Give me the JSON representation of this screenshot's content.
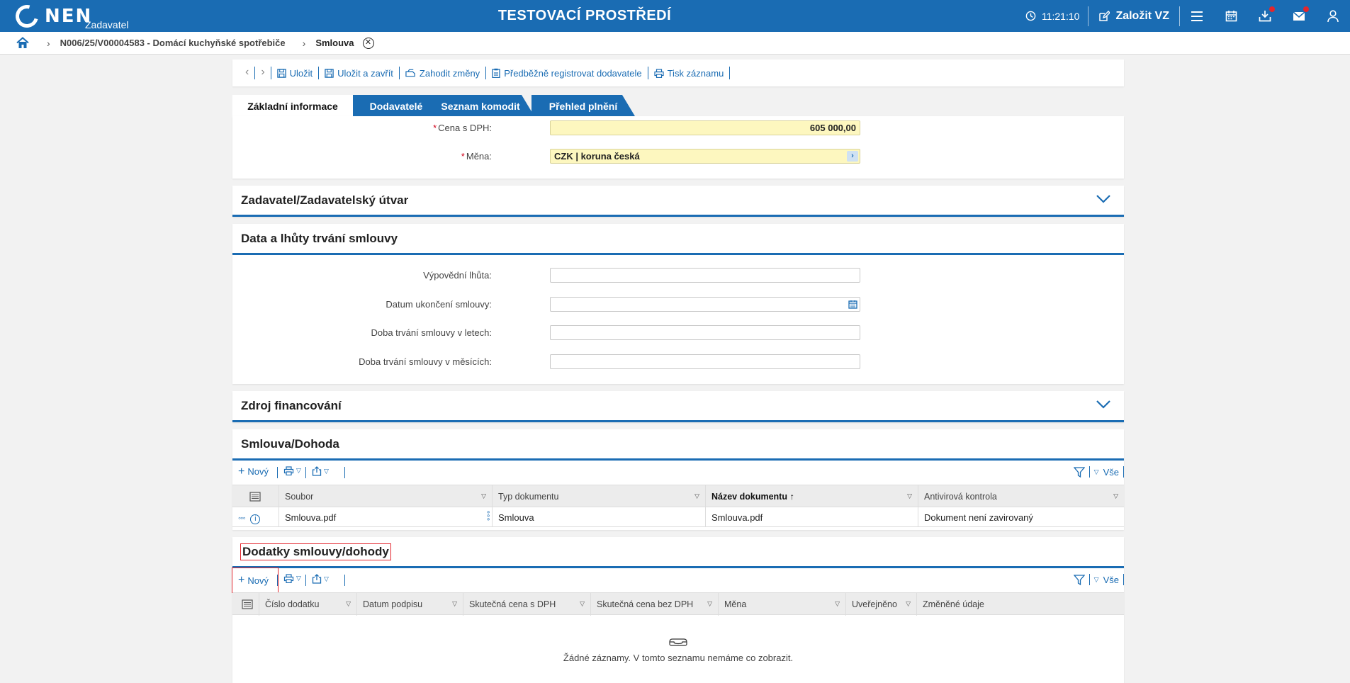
{
  "topbar": {
    "logo_text": "NEN",
    "logo_sub": "Zadavatel",
    "env_title": "TESTOVACÍ PROSTŘEDÍ",
    "time": "11:21:10",
    "create_label": "Založit VZ",
    "icons": [
      "clock-icon",
      "edit-icon",
      "menu-icon",
      "calendar-icon",
      "download-icon",
      "mail-icon",
      "user-icon"
    ]
  },
  "breadcrumb": {
    "link": "N006/25/V00004583 - Domácí kuchyňské spotřebiče",
    "current": "Smlouva"
  },
  "toolbar": {
    "save": "Uložit",
    "save_close": "Uložit a zavřít",
    "discard": "Zahodit změny",
    "preregister": "Předběžně registrovat dodavatele",
    "print": "Tisk záznamu"
  },
  "tabs": [
    {
      "label": "Základní informace",
      "active": true
    },
    {
      "label": "Dodavatelé",
      "active": false
    },
    {
      "label": "Seznam komodit",
      "active": false
    },
    {
      "label": "Přehled plnění",
      "active": false
    }
  ],
  "basic": {
    "price_label": "Cena s DPH:",
    "price_value": "605 000,00",
    "currency_label": "Měna:",
    "currency_value": "CZK | koruna česká"
  },
  "sections": {
    "contracting": "Zadavatel/Zadavatelský útvar",
    "dates": "Data a lhůty trvání smlouvy",
    "funding": "Zdroj financování",
    "contract": "Smlouva/Dohoda",
    "amendments": "Dodatky smlouvy/dohody"
  },
  "dates_fields": [
    {
      "label": "Výpovědní lhůta:",
      "value": ""
    },
    {
      "label": "Datum ukončení smlouvy:",
      "value": ""
    },
    {
      "label": "Doba trvání smlouvy v letech:",
      "value": ""
    },
    {
      "label": "Doba trvání smlouvy v měsících:",
      "value": ""
    }
  ],
  "grid_common": {
    "new_label": "Nový",
    "all_label": "Vše"
  },
  "contract_grid": {
    "columns": [
      "Soubor",
      "Typ dokumentu",
      "Název dokumentu",
      "Antivirová kontrola"
    ],
    "rows": [
      {
        "file": "Smlouva.pdf",
        "type": "Smlouva",
        "name": "Smlouva.pdf",
        "antivirus": "Dokument není zavirovaný"
      }
    ]
  },
  "amendments_grid": {
    "columns": [
      "Číslo dodatku",
      "Datum podpisu",
      "Skutečná cena s DPH",
      "Skutečná cena bez DPH",
      "Měna",
      "Uveřejněno",
      "Změněné údaje"
    ],
    "empty_text": "Žádné záznamy. V tomto seznamu nemáme co zobrazit."
  },
  "colors": {
    "brand": "#1a6cb3",
    "highlight": "#e3262d",
    "required_input": "#fdf7bf"
  }
}
